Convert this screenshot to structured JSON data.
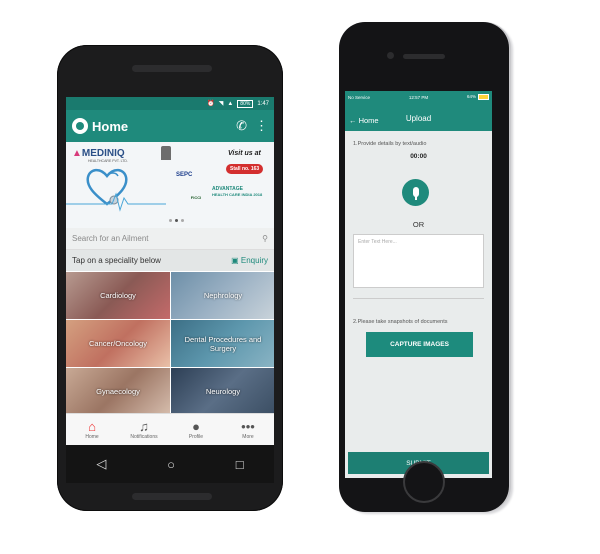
{
  "android": {
    "status": {
      "battery": "80%",
      "time": "1:47"
    },
    "appbar": {
      "title": "Home",
      "logo_text": "MEDINIQ"
    },
    "banner": {
      "brand": "MEDINIQ",
      "brand_sub": "HEALTHCARE PVT. LTD.",
      "visit": "Visit us at",
      "stall": "Stall no. 163",
      "sepc": "SEPC",
      "ficci": "FICCI",
      "advantage": "ADVANTAGE",
      "advantage_sub": "HEALTH CARE INDIA 2018"
    },
    "search": {
      "placeholder": "Search for an Ailment"
    },
    "tap": {
      "label": "Tap on a speciality below",
      "enquiry": "Enquiry"
    },
    "specialities": [
      "Cardiology",
      "Nephrology",
      "Cancer/Oncology",
      "Dental Procedures and Surgery",
      "Gynaecology",
      "Neurology"
    ],
    "bottom_nav": [
      "Home",
      "Notifications",
      "Profile",
      "More"
    ]
  },
  "iphone": {
    "status": {
      "carrier": "No Service",
      "time": "12:57 PM",
      "battery": "64%"
    },
    "nav": {
      "back": "Home",
      "title": "Upload"
    },
    "step1": "1.Provide details by text/audio",
    "timer": "00:00",
    "or": "OR",
    "text_placeholder": "Enter Text Here...",
    "step2": "2.Please take snapshots of documents",
    "capture": "CAPTURE IMAGES",
    "submit": "SUBMIT"
  },
  "colors": {
    "teal": "#1f8a7c",
    "home_active": "#e33333"
  }
}
